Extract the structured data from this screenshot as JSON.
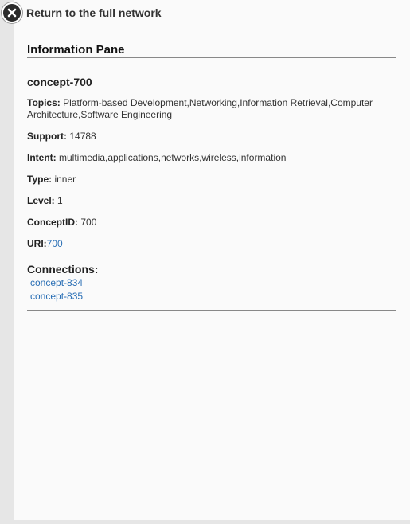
{
  "nav": {
    "back_label": "Return to the full network",
    "back_icon": "close-icon"
  },
  "pane": {
    "title": "Information Pane",
    "concept_name": "concept-700",
    "fields": {
      "topics": {
        "label": "Topics:",
        "value": "Platform-based Development,Networking,Information Retrieval,Computer Architecture,Software Engineering"
      },
      "support": {
        "label": "Support:",
        "value": "14788"
      },
      "intent": {
        "label": "Intent:",
        "value": "multimedia,applications,networks,wireless,information"
      },
      "type": {
        "label": "Type:",
        "value": "inner"
      },
      "level": {
        "label": "Level:",
        "value": "1"
      },
      "concept_id": {
        "label": "ConceptID:",
        "value": "700"
      },
      "uri": {
        "label": "URI:",
        "value": "700"
      }
    },
    "connections_title": "Connections:",
    "connections": [
      "concept-834",
      "concept-835"
    ]
  },
  "colors": {
    "link": "#2a6fb5",
    "background": "#fafafa",
    "sidebar": "#e6e6e6"
  }
}
